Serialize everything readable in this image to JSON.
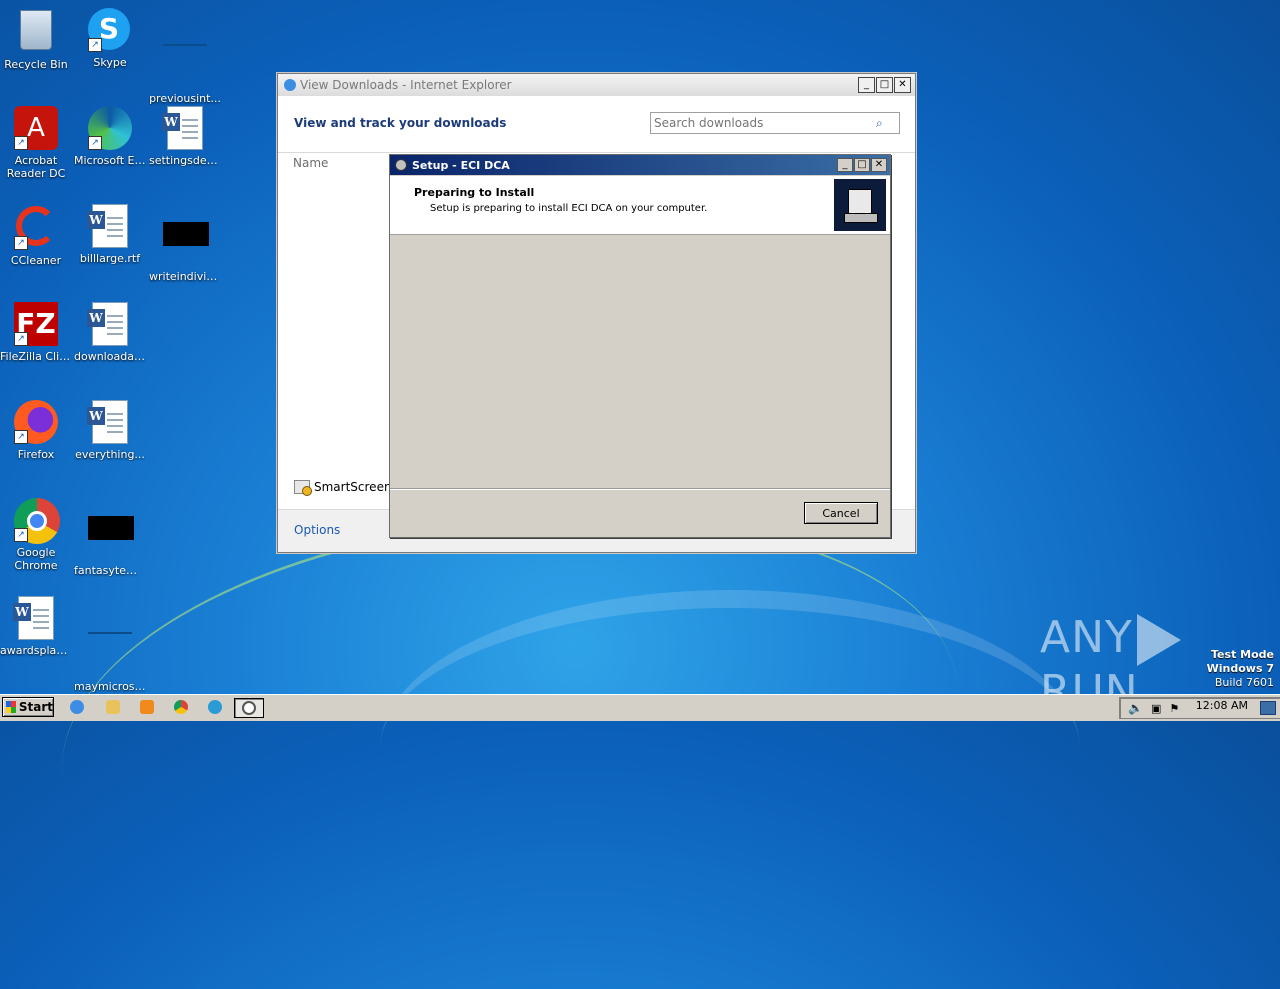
{
  "desktop": {
    "icons": [
      {
        "label": "Recycle Bin"
      },
      {
        "label": "Skype"
      },
      {
        "label": "previousint..."
      },
      {
        "label": "Acrobat Reader DC"
      },
      {
        "label": "Microsoft Edge"
      },
      {
        "label": "settingsdea..."
      },
      {
        "label": "CCleaner"
      },
      {
        "label": "billlarge.rtf"
      },
      {
        "label": "writeindivid..."
      },
      {
        "label": "FileZilla Client"
      },
      {
        "label": "downloadar..."
      },
      {
        "label": "Firefox"
      },
      {
        "label": "everything..."
      },
      {
        "label": "Google Chrome"
      },
      {
        "label": "fantasytem..."
      },
      {
        "label": "awardsplan..."
      },
      {
        "label": "maymicroso..."
      }
    ]
  },
  "ie_window": {
    "title": "View Downloads - Internet Explorer",
    "heading": "View and track your downloads",
    "search_placeholder": "Search downloads",
    "column_name": "Name",
    "smartscreen_label": "SmartScreen",
    "options_label": "Options"
  },
  "setup_dialog": {
    "title": "Setup - ECI DCA",
    "header_title": "Preparing to Install",
    "header_subtitle": "Setup is preparing to install ECI DCA on your computer.",
    "cancel_label": "Cancel"
  },
  "watermark": {
    "brand_left": "ANY",
    "brand_right": "RUN",
    "line1": "Test Mode",
    "line2": "Windows 7",
    "line3": "Build 7601"
  },
  "taskbar": {
    "start_label": "Start",
    "clock": "12:08 AM"
  }
}
